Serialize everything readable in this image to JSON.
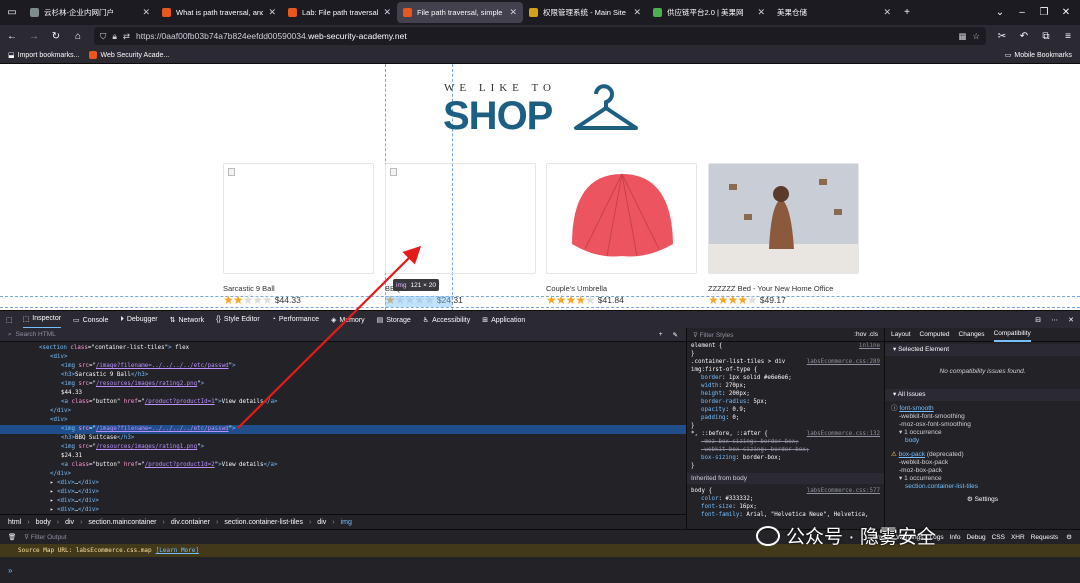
{
  "tabs": [
    {
      "title": "云杉林-企业内网门户",
      "favicon": "#7f8c8d",
      "active": false
    },
    {
      "title": "What is path traversal, and h",
      "favicon": "#e8571b",
      "active": false
    },
    {
      "title": "Lab: File path traversal, simp",
      "favicon": "#e8571b",
      "active": false
    },
    {
      "title": "File path traversal, simple ca",
      "favicon": "#e8571b",
      "active": true
    },
    {
      "title": "权限管理系统 - Main Site",
      "favicon": "#d4a017",
      "active": false
    },
    {
      "title": "供应链平台2.0 | 美果网",
      "favicon": "#4caf50",
      "active": false
    },
    {
      "title": "美果仓储",
      "favicon": "",
      "active": false
    }
  ],
  "nav": {
    "url_host": "https://0aaf00fb03b74a7b824eefdd00590034.",
    "url_domain": "web-security-academy.net"
  },
  "bookmarks": {
    "items": [
      "Import bookmarks...",
      "Web Security Acade..."
    ],
    "mobile": "Mobile Bookmarks"
  },
  "shop": {
    "tagline": "WE LIKE TO",
    "logo": "SHOP"
  },
  "products": [
    {
      "name": "Sarcastic 9 Ball",
      "rating": 2,
      "price": "$44.33",
      "image": "broken"
    },
    {
      "name": "BBQ Suitcase",
      "rating": 1,
      "price": "$24.31",
      "image": "broken"
    },
    {
      "name": "Couple's Umbrella",
      "rating": 4,
      "price": "$41.84",
      "image": "umbrella"
    },
    {
      "name": "ZZZZZZ Bed - Your New Home Office",
      "rating": 4,
      "price": "$49.17",
      "image": "bed"
    }
  ],
  "highlight_tip": {
    "tag": "img",
    "size": "121 × 20"
  },
  "devtools": {
    "tabs": [
      "Inspector",
      "Console",
      "Debugger",
      "Network",
      "Style Editor",
      "Performance",
      "Memory",
      "Storage",
      "Accessibility",
      "Application"
    ],
    "search_placeholder": "Search HTML",
    "markup": [
      {
        "indent": 3,
        "html": "<span class='tg'>&lt;section</span> <span class='at'>class</span>=\"container-list-tiles\"<span class='tg'>&gt;</span> flex"
      },
      {
        "indent": 4,
        "html": "<span class='tg'>&lt;div&gt;</span>"
      },
      {
        "indent": 5,
        "html": "<span class='tg'>&lt;img</span> <span class='at'>src</span>=\"<span class='av'>/image?filename=../../../../etc/passwd</span>\"<span class='tg'>&gt;</span>"
      },
      {
        "indent": 5,
        "html": "<span class='tg'>&lt;h3&gt;</span>Sarcastic 9 Ball<span class='tg'>&lt;/h3&gt;</span>"
      },
      {
        "indent": 5,
        "html": "<span class='tg'>&lt;img</span> <span class='at'>src</span>=\"<span class='av'>/resources/images/rating2.png</span>\"<span class='tg'>&gt;</span>"
      },
      {
        "indent": 5,
        "html": "$44.33"
      },
      {
        "indent": 5,
        "html": "<span class='tg'>&lt;a</span> <span class='at'>class</span>=\"button\" <span class='at'>href</span>=\"<span class='av'>/product?productId=1</span>\"<span class='tg'>&gt;</span>View details<span class='tg'>&lt;/a&gt;</span>"
      },
      {
        "indent": 4,
        "html": "<span class='tg'>&lt;/div&gt;</span>"
      },
      {
        "indent": 4,
        "html": "<span class='tg'>&lt;div&gt;</span>"
      },
      {
        "indent": 5,
        "html": "<span class='tg'>&lt;img</span> <span class='at'>src</span>=\"<span class='av'>/image?filename=../../../../etc/passwd</span>\"<span class='tg'>&gt;</span>",
        "selected": true
      },
      {
        "indent": 5,
        "html": "<span class='tg'>&lt;h3&gt;</span>BBQ Suitcase<span class='tg'>&lt;/h3&gt;</span>"
      },
      {
        "indent": 5,
        "html": "<span class='tg'>&lt;img</span> <span class='at'>src</span>=\"<span class='av'>/resources/images/rating1.png</span>\"<span class='tg'>&gt;</span>"
      },
      {
        "indent": 5,
        "html": "$24.31"
      },
      {
        "indent": 5,
        "html": "<span class='tg'>&lt;a</span> <span class='at'>class</span>=\"button\" <span class='at'>href</span>=\"<span class='av'>/product?productId=2</span>\"<span class='tg'>&gt;</span>View details<span class='tg'>&lt;/a&gt;</span>"
      },
      {
        "indent": 4,
        "html": "<span class='tg'>&lt;/div&gt;</span>"
      },
      {
        "indent": 4,
        "html": "▸ <span class='tg'>&lt;div&gt;</span>…<span class='tg'>&lt;/div&gt;</span>"
      },
      {
        "indent": 4,
        "html": "▸ <span class='tg'>&lt;div&gt;</span>…<span class='tg'>&lt;/div&gt;</span>"
      },
      {
        "indent": 4,
        "html": "▸ <span class='tg'>&lt;div&gt;</span>…<span class='tg'>&lt;/div&gt;</span>"
      },
      {
        "indent": 4,
        "html": "▸ <span class='tg'>&lt;div&gt;</span>…<span class='tg'>&lt;/div&gt;</span>"
      },
      {
        "indent": 4,
        "html": "▸ <span class='tg'>&lt;div&gt;</span>…<span class='tg'>&lt;/div&gt;</span>"
      }
    ],
    "breadcrumbs": [
      "html",
      "body",
      "div",
      "section.maincontainer",
      "div.container",
      "section.container-list-tiles",
      "div",
      "img"
    ],
    "rules_filter": "Filter Styles",
    "rules_tools": ":hov .cls",
    "rules": [
      {
        "t": "element { <span class='src'>inline</span>",
        "c": ""
      },
      {
        "t": "}",
        "c": ""
      },
      {
        "t": ".container-list-tiles > div <span class='src'>labsEcommerce.css:289</span>",
        "c": ""
      },
      {
        "t": "img:first-of-type {",
        "c": ""
      },
      {
        "t": "<span class='pr'>border</span>: 1px solid #e6e6e6;",
        "c": "ind"
      },
      {
        "t": "<span class='pr'>width</span>: 270px;",
        "c": "ind"
      },
      {
        "t": "<span class='pr'>height</span>: 200px;",
        "c": "ind"
      },
      {
        "t": "<span class='pr'>border-radius</span>: 5px;",
        "c": "ind"
      },
      {
        "t": "<span class='pr'>opacity</span>: 0.9;",
        "c": "ind"
      },
      {
        "t": "<span class='pr'>padding</span>: 0;",
        "c": "ind"
      },
      {
        "t": "}",
        "c": ""
      },
      {
        "t": "*, ::before, ::after { <span class='src'>labsEcommerce.css:132</span>",
        "c": ""
      },
      {
        "t": "<span class='strike'>-moz-box-sizing: border-box;</span>",
        "c": "ind"
      },
      {
        "t": "<span class='strike'>-webkit-box-sizing: border-box;</span>",
        "c": "ind"
      },
      {
        "t": "<span class='pr'>box-sizing</span>: border-box;",
        "c": "ind"
      },
      {
        "t": "}",
        "c": ""
      }
    ],
    "inherited_label": "Inherited from body",
    "inherited": [
      {
        "t": "body { <span class='src'>labsEcommerce.css:577</span>",
        "c": ""
      },
      {
        "t": "<span class='pr'>color</span>: #333332;",
        "c": "ind"
      },
      {
        "t": "<span class='pr'>font-size</span>: 16px;",
        "c": "ind"
      },
      {
        "t": "<span class='pr'>font-family</span>: Arial, \"Helvetica Neue\", Helvetica,",
        "c": "ind"
      }
    ],
    "compat_tabs": [
      "Layout",
      "Computed",
      "Changes",
      "Compatibility"
    ],
    "selected_element": "Selected Element",
    "no_issues": "No compatibility issues found.",
    "all_issues": "All Issues",
    "issue1": {
      "prop": "font-smooth",
      "a": "-webkit-font-smoothing",
      "b": "-moz-osx-font-smoothing",
      "occ": "1 occurrence",
      "where": "body"
    },
    "issue2": {
      "prop": "box-pack",
      "note": "(deprecated)",
      "a": "-webkit-box-pack",
      "b": "-moz-box-pack",
      "occ": "1 occurrence",
      "where": "section.container-list-tiles"
    },
    "settings": "Settings",
    "console_filter": "Filter Output",
    "console_chips": [
      "Errors",
      "Warnings",
      "Logs",
      "Info",
      "Debug",
      "CSS",
      "XHR",
      "Requests"
    ],
    "source_map": "Source Map URL: labsEcommerce.css.map",
    "learn_more": "[Learn More]",
    "prompt": "»"
  },
  "watermark": "公众号 · 隐雾安全"
}
